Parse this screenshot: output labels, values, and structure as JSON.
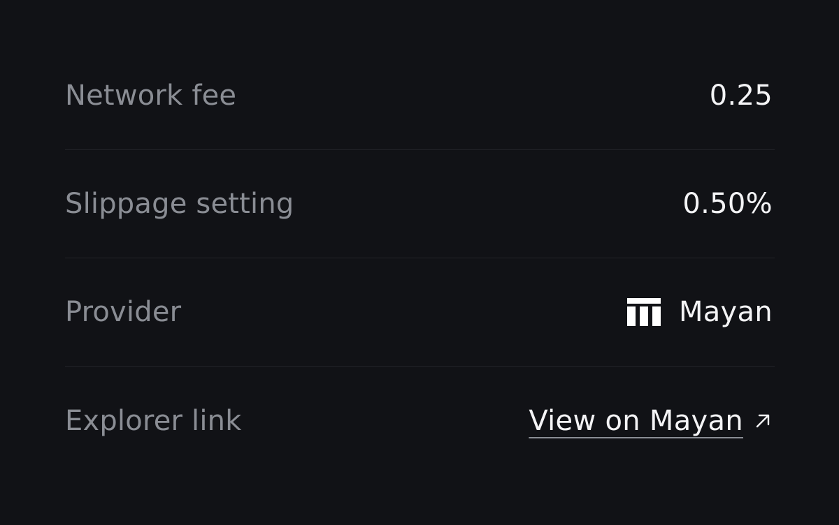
{
  "rows": [
    {
      "label": "Network fee",
      "value": "0.25"
    },
    {
      "label": "Slippage setting",
      "value": "0.50%"
    },
    {
      "label": "Provider",
      "value": "Mayan",
      "icon": "mayan-logo-icon"
    },
    {
      "label": "Explorer link",
      "value": "View on Mayan",
      "icon": "arrow-up-right-icon"
    }
  ],
  "colors": {
    "background": "#111216",
    "label": "#8a8d94",
    "value": "#f4f4f6",
    "divider": "#232429"
  }
}
